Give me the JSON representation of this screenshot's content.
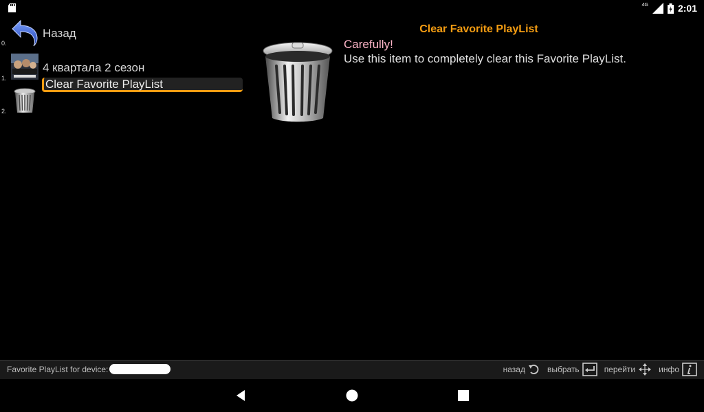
{
  "status_bar": {
    "network": "4G",
    "time": "2:01",
    "icons": [
      "sd-card-icon",
      "signal-icon",
      "battery-icon"
    ]
  },
  "list": {
    "items": [
      {
        "index": "0.",
        "label": "Назад",
        "icon": "back-arrow-icon"
      },
      {
        "index": "1.",
        "label": "4 квартала 2 сезон",
        "icon": "video-thumbnail"
      },
      {
        "index": "2.",
        "label": "Clear Favorite PlayList",
        "icon": "trash-can-icon",
        "selected": true
      }
    ]
  },
  "detail": {
    "title": "Clear Favorite PlayList",
    "warning": "Carefully!",
    "description": "Use this item to completely clear this Favorite PlayList.",
    "icon": "trash-can-icon"
  },
  "bottom_bar": {
    "device_label": "Favorite PlayList for device:",
    "hints": {
      "back": "назад",
      "select": "выбрать",
      "navigate": "перейти",
      "info": "инфо"
    }
  },
  "colors": {
    "accent": "#f39c12",
    "warning": "#ffb6c9",
    "background": "#000000"
  }
}
